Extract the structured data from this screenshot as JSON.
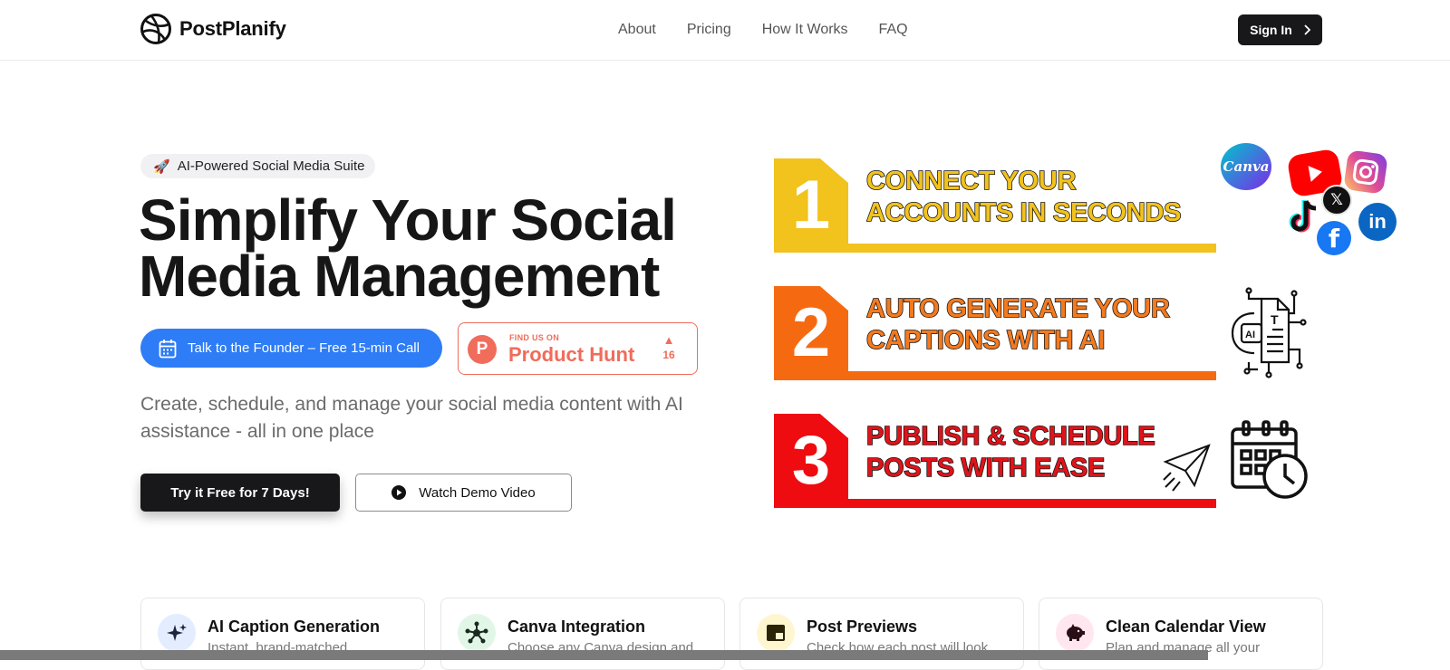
{
  "brand": {
    "name": "PostPlanify"
  },
  "nav": {
    "links": [
      "About",
      "Pricing",
      "How It Works",
      "FAQ"
    ],
    "signin_label": "Sign In"
  },
  "hero": {
    "badge_emoji": "🚀",
    "badge_text": "AI-Powered Social Media Suite",
    "title_line1": "Simplify Your Social",
    "title_line2": "Media Management",
    "founder_button": "Talk to the Founder – Free 15-min Call",
    "product_hunt": {
      "small": "FIND US ON",
      "big": "Product Hunt",
      "logo_letter": "P",
      "votes": "16"
    },
    "subtitle": "Create, schedule, and manage your social media content with AI assistance - all in one place",
    "try_button": "Try it Free for 7 Days!",
    "demo_button": "Watch Demo Video"
  },
  "steps": [
    {
      "number": "1",
      "line1": "CONNECT YOUR",
      "line2": "ACCOUNTS IN SECONDS",
      "color": "#f2c21d",
      "text_color": "#f2c21d",
      "icon": "social-icons-cluster"
    },
    {
      "number": "2",
      "line1": "AUTO GENERATE YOUR",
      "line2": "CAPTIONS WITH AI",
      "color": "#f56a11",
      "text_color": "#f47a1e",
      "icon": "ai-document-icon"
    },
    {
      "number": "3",
      "line1": "PUBLISH & SCHEDULE",
      "line2": "POSTS WITH EASE",
      "color": "#ee0c10",
      "text_color": "#e0131a",
      "icon": "calendar-clock-icon"
    }
  ],
  "social": {
    "canva": "Canva",
    "linkedin": "in",
    "facebook": "f",
    "x": "𝕏"
  },
  "ai_icon_labels": {
    "ai": "AI",
    "t": "T"
  },
  "features": [
    {
      "title": "AI Caption Generation",
      "desc": "Instant, brand-matched",
      "icon": "sparkles-icon",
      "bg": "#e3edff",
      "fg": "#1b2440"
    },
    {
      "title": "Canva Integration",
      "desc": "Choose any Canva design and",
      "icon": "nodes-icon",
      "bg": "#e2f6e8",
      "fg": "#1b2a1f"
    },
    {
      "title": "Post Previews",
      "desc": "Check how each post will look",
      "icon": "preview-icon",
      "bg": "#fff6cf",
      "fg": "#2a2308"
    },
    {
      "title": "Clean Calendar View",
      "desc": "Plan and manage all your",
      "icon": "piggy-bank-icon",
      "bg": "#ffe6ef",
      "fg": "#2a1016"
    }
  ]
}
